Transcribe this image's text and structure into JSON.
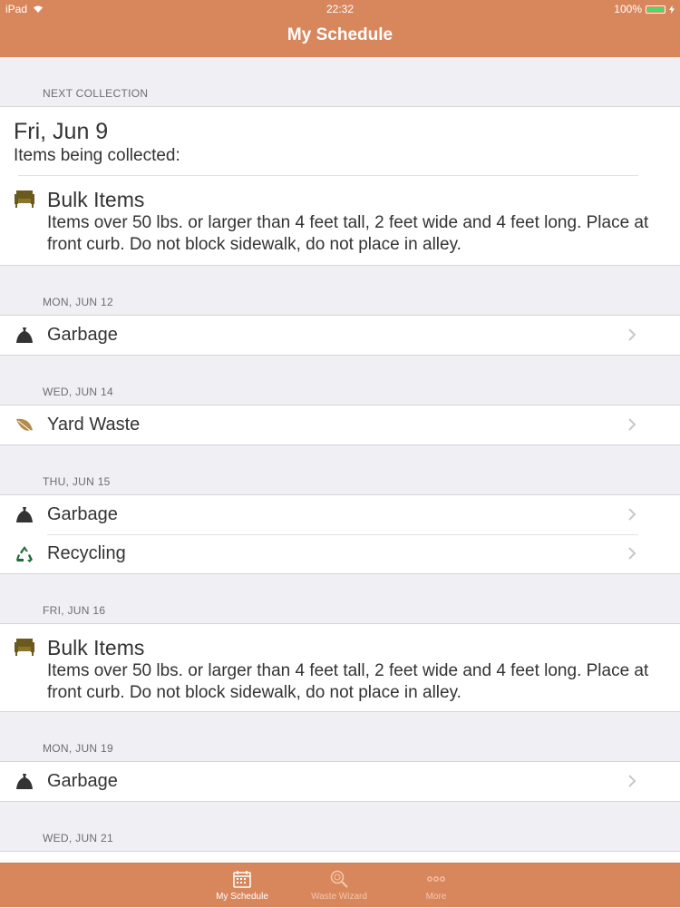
{
  "status_bar": {
    "device": "iPad",
    "time": "22:32",
    "battery": "100%"
  },
  "header": {
    "title": "My Schedule"
  },
  "next_collection": {
    "section_label": "NEXT COLLECTION",
    "date": "Fri, Jun 9",
    "subtitle": "Items being collected:",
    "item": {
      "title": "Bulk Items",
      "description": "Items over 50 lbs. or larger than 4 feet tall, 2 feet wide and 4 feet long. Place at front curb. Do not block sidewalk, do not place in alley."
    }
  },
  "schedule": [
    {
      "date": "MON, JUN 12",
      "items": [
        {
          "label": "Garbage",
          "icon": "garbage-bag-icon"
        }
      ]
    },
    {
      "date": "WED, JUN 14",
      "items": [
        {
          "label": "Yard Waste",
          "icon": "leaf-icon"
        }
      ]
    },
    {
      "date": "THU, JUN 15",
      "items": [
        {
          "label": "Garbage",
          "icon": "garbage-bag-icon"
        },
        {
          "label": "Recycling",
          "icon": "recycling-icon"
        }
      ]
    },
    {
      "date": "FRI, JUN 16",
      "bulk": {
        "title": "Bulk Items",
        "description": "Items over 50 lbs. or larger than 4 feet tall, 2 feet wide and 4 feet long. Place at front curb. Do not block sidewalk, do not place in alley."
      }
    },
    {
      "date": "MON, JUN 19",
      "items": [
        {
          "label": "Garbage",
          "icon": "garbage-bag-icon"
        }
      ]
    },
    {
      "date": "WED, JUN 21",
      "items": []
    }
  ],
  "tabs": [
    {
      "label": "My Schedule",
      "icon": "calendar-icon",
      "active": true
    },
    {
      "label": "Waste Wizard",
      "icon": "magnifier-icon",
      "active": false
    },
    {
      "label": "More",
      "icon": "more-dots-icon",
      "active": false
    }
  ],
  "colors": {
    "accent": "#d8875c",
    "background": "#efeff4",
    "recycling_green": "#1e6b3a",
    "leaf_brown": "#b58a4a",
    "bulk_brown": "#6b5a1e"
  }
}
